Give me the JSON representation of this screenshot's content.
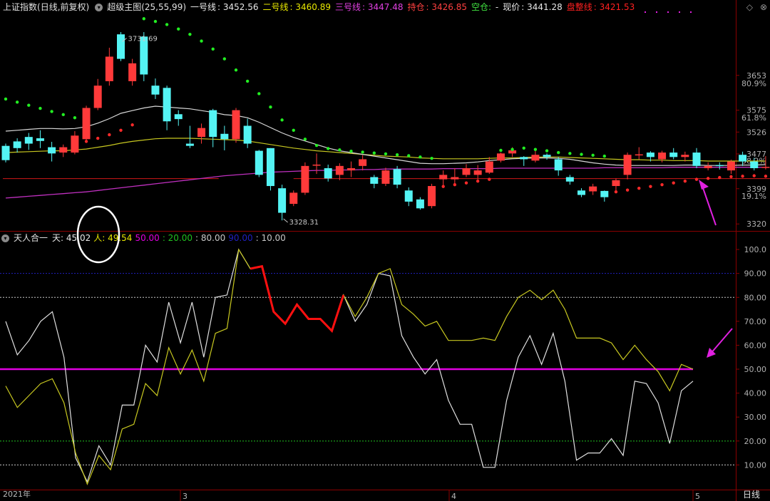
{
  "top_panel": {
    "index_name": "上证指数",
    "period_label": "(日线,前复权)",
    "indicator_name": "超级主图(25,55,99)",
    "lines": [
      {
        "label": "一号线",
        "value": "3452.56",
        "color": "#e8e8e8"
      },
      {
        "label": "二号线",
        "value": "3460.89",
        "color": "#e8e800"
      },
      {
        "label": "三号线",
        "value": "3447.48",
        "color": "#e040e0"
      },
      {
        "label": "持仓",
        "value": "3426.85",
        "color": "#ff4040"
      },
      {
        "label": "空仓",
        "value": "-",
        "color": "#40e040"
      },
      {
        "label": "现价",
        "value": "3441.28",
        "color": "#e8e8e8"
      },
      {
        "label": "盘整线",
        "value": "3421.53",
        "color": "#ff2020"
      }
    ],
    "y_ticks": [
      {
        "value": 3653,
        "label": "3653"
      },
      {
        "value": 3575,
        "label": "3575"
      },
      {
        "value": 3526,
        "label": "3526"
      },
      {
        "value": 3477,
        "label": "3477"
      },
      {
        "value": 3399,
        "label": "3399"
      },
      {
        "value": 3320,
        "label": "3320"
      }
    ],
    "pct_ticks": [
      {
        "value": 3635,
        "label": "80.9%"
      },
      {
        "value": 3558,
        "label": "61.8%"
      },
      {
        "value": 3462,
        "label": "38.2%"
      },
      {
        "value": 3383,
        "label": "19.1%"
      }
    ],
    "high_label": "3731.69",
    "low_label": "3328.31",
    "ylim": [
      3306,
      3790
    ]
  },
  "bottom_panel": {
    "indicator_name": "天人合一",
    "items": [
      {
        "label": "天: 45.02",
        "color": "#e8e8e8"
      },
      {
        "label": "人: 49.54",
        "color": "#e8e800"
      },
      {
        "label": "50.00",
        "color": "#e000e0"
      },
      {
        "label": ": 20.00",
        "color": "#20c020"
      },
      {
        "label": ": 80.00",
        "color": "#c8c8c8"
      },
      {
        "label": "90.00",
        "color": "#2020c0"
      },
      {
        "label": ": 10.00",
        "color": "#c8c8c8"
      }
    ],
    "y_ticks": [
      "100.0",
      "90.00",
      "80.00",
      "70.00",
      "60.00",
      "50.00",
      "40.00",
      "30.00",
      "20.00",
      "10.00"
    ],
    "ylim": [
      0,
      103
    ]
  },
  "x_axis": {
    "year_label": "2021年",
    "month_labels": [
      "3",
      "4",
      "5"
    ],
    "timeframe": "日线"
  },
  "colors": {
    "up": "#ff3a3a",
    "down": "#54f4f4",
    "sar_up": "#ff2a2a",
    "sar_down": "#22ee22"
  },
  "chart_data": [
    {
      "type": "candlestick",
      "title": "上证指数 超级主图(25,55,99)",
      "candles": [
        [
          3495,
          3463,
          3500,
          3458
        ],
        [
          3505,
          3490,
          3512,
          3480
        ],
        [
          3515,
          3500,
          3524,
          3486
        ],
        [
          3512,
          3506,
          3530,
          3490
        ],
        [
          3492,
          3478,
          3504,
          3460
        ],
        [
          3480,
          3492,
          3498,
          3470
        ],
        [
          3480,
          3518,
          3528,
          3476
        ],
        [
          3510,
          3580,
          3585,
          3506
        ],
        [
          3580,
          3630,
          3645,
          3575
        ],
        [
          3640,
          3695,
          3715,
          3630
        ],
        [
          3745,
          3690,
          3750,
          3685
        ],
        [
          3640,
          3680,
          3690,
          3630
        ],
        [
          3740,
          3655,
          3750,
          3640
        ],
        [
          3630,
          3610,
          3646,
          3600
        ],
        [
          3625,
          3550,
          3630,
          3530
        ],
        [
          3566,
          3555,
          3575,
          3540
        ],
        [
          3500,
          3495,
          3540,
          3490
        ],
        [
          3515,
          3535,
          3545,
          3500
        ],
        [
          3575,
          3515,
          3578,
          3492
        ],
        [
          3522,
          3510,
          3540,
          3485
        ],
        [
          3510,
          3575,
          3580,
          3502
        ],
        [
          3540,
          3500,
          3556,
          3490
        ],
        [
          3484,
          3430,
          3486,
          3425
        ],
        [
          3490,
          3405,
          3490,
          3395
        ],
        [
          3400,
          3345,
          3408,
          3328
        ],
        [
          3365,
          3390,
          3395,
          3360
        ],
        [
          3390,
          3450,
          3458,
          3385
        ],
        [
          3452,
          3453,
          3478,
          3432
        ],
        [
          3445,
          3422,
          3453,
          3415
        ],
        [
          3430,
          3450,
          3456,
          3418
        ],
        [
          3440,
          3445,
          3460,
          3425
        ],
        [
          3450,
          3465,
          3474,
          3440
        ],
        [
          3425,
          3410,
          3430,
          3400
        ],
        [
          3410,
          3440,
          3446,
          3405
        ],
        [
          3443,
          3408,
          3450,
          3400
        ],
        [
          3395,
          3370,
          3402,
          3360
        ],
        [
          3375,
          3355,
          3380,
          3352
        ],
        [
          3360,
          3405,
          3410,
          3355
        ],
        [
          3420,
          3430,
          3440,
          3406
        ],
        [
          3420,
          3425,
          3445,
          3405
        ],
        [
          3430,
          3445,
          3454,
          3425
        ],
        [
          3430,
          3440,
          3452,
          3420
        ],
        [
          3435,
          3460,
          3470,
          3432
        ],
        [
          3462,
          3478,
          3480,
          3458
        ],
        [
          3478,
          3485,
          3492,
          3470
        ],
        [
          3470,
          3465,
          3472,
          3450
        ],
        [
          3462,
          3475,
          3487,
          3458
        ],
        [
          3475,
          3470,
          3478,
          3464
        ],
        [
          3465,
          3440,
          3470,
          3428
        ],
        [
          3425,
          3415,
          3430,
          3408
        ],
        [
          3395,
          3385,
          3400,
          3380
        ],
        [
          3393,
          3404,
          3410,
          3385
        ],
        [
          3394,
          3380,
          3395,
          3370
        ],
        [
          3405,
          3418,
          3422,
          3395
        ],
        [
          3430,
          3475,
          3480,
          3420
        ],
        [
          3475,
          3476,
          3492,
          3465
        ],
        [
          3480,
          3470,
          3483,
          3460
        ],
        [
          3465,
          3480,
          3484,
          3458
        ],
        [
          3480,
          3470,
          3490,
          3465
        ],
        [
          3470,
          3475,
          3482,
          3460
        ],
        [
          3480,
          3450,
          3490,
          3445
        ],
        [
          3445,
          3450,
          3458,
          3440
        ],
        [
          3452,
          3450,
          3458,
          3442
        ],
        [
          3440,
          3460,
          3464,
          3432
        ],
        [
          3475,
          3460,
          3482,
          3450
        ],
        [
          3460,
          3445,
          3468,
          3440
        ],
        [
          3446,
          3448,
          3472,
          3442
        ]
      ],
      "line1": [
        3528,
        3530,
        3532,
        3534,
        3534,
        3533,
        3534,
        3538,
        3546,
        3556,
        3568,
        3574,
        3580,
        3584,
        3582,
        3580,
        3578,
        3574,
        3570,
        3565,
        3563,
        3558,
        3548,
        3536,
        3524,
        3514,
        3506,
        3498,
        3490,
        3484,
        3480,
        3476,
        3472,
        3468,
        3464,
        3460,
        3456,
        3455,
        3455,
        3456,
        3457,
        3459,
        3462,
        3464,
        3466,
        3467,
        3468,
        3468,
        3467,
        3465,
        3461,
        3457,
        3454,
        3452,
        3451,
        3451,
        3451,
        3451,
        3451,
        3452,
        3452,
        3451,
        3451,
        3451,
        3452,
        3452,
        3453
      ],
      "line2": [
        3480,
        3481,
        3482,
        3483,
        3484,
        3484,
        3486,
        3488,
        3492,
        3496,
        3501,
        3505,
        3508,
        3511,
        3512,
        3512,
        3512,
        3511,
        3510,
        3509,
        3508,
        3506,
        3502,
        3498,
        3494,
        3490,
        3487,
        3484,
        3482,
        3480,
        3478,
        3476,
        3474,
        3472,
        3471,
        3470,
        3468,
        3467,
        3466,
        3466,
        3466,
        3466,
        3467,
        3468,
        3468,
        3469,
        3470,
        3470,
        3470,
        3469,
        3468,
        3467,
        3466,
        3465,
        3464,
        3464,
        3463,
        3463,
        3462,
        3462,
        3462,
        3461,
        3461,
        3461,
        3461,
        3461,
        3461
      ],
      "line3": [
        3378,
        3380,
        3382,
        3384,
        3386,
        3388,
        3390,
        3392,
        3395,
        3398,
        3401,
        3404,
        3407,
        3410,
        3413,
        3416,
        3419,
        3422,
        3425,
        3428,
        3430,
        3432,
        3434,
        3436,
        3437,
        3438,
        3439,
        3440,
        3440,
        3441,
        3441,
        3442,
        3442,
        3443,
        3443,
        3443,
        3443,
        3443,
        3444,
        3444,
        3444,
        3444,
        3444,
        3445,
        3445,
        3445,
        3445,
        3445,
        3445,
        3445,
        3445,
        3445,
        3446,
        3446,
        3446,
        3446,
        3446,
        3446,
        3447,
        3447,
        3447,
        3447,
        3447,
        3447,
        3447,
        3447,
        3447
      ],
      "sar_down": [
        3600,
        3593,
        3586,
        3579,
        3572,
        3565,
        3558,
        null,
        null,
        null,
        null,
        null,
        3780,
        3774,
        3767,
        3757,
        3745,
        3730,
        3712,
        3690,
        3665,
        3640,
        3612,
        3582,
        3553,
        3530,
        3510,
        3496,
        3489,
        3486,
        3483,
        3481,
        3479,
        3477,
        3475,
        3473,
        3470,
        3467,
        null,
        null,
        null,
        null,
        null,
        3485,
        3487,
        3490,
        3487,
        3484,
        3480,
        3478,
        3476,
        3474,
        3472,
        null,
        null,
        null,
        null,
        null,
        null,
        null,
        null,
        null,
        null,
        null,
        null,
        null,
        null
      ],
      "sar_up": [
        null,
        null,
        null,
        null,
        null,
        null,
        null,
        3505,
        3512,
        3520,
        3530,
        3542,
        null,
        null,
        null,
        null,
        null,
        null,
        null,
        null,
        null,
        null,
        null,
        null,
        null,
        null,
        null,
        null,
        null,
        null,
        null,
        null,
        null,
        null,
        null,
        null,
        null,
        null,
        3404,
        3408,
        3412,
        3416,
        3420,
        null,
        null,
        null,
        null,
        null,
        null,
        null,
        null,
        null,
        null,
        3392,
        3396,
        3400,
        3404,
        3408,
        3412,
        3416,
        3420,
        3422,
        3424,
        3426,
        3427,
        3428,
        3427
      ],
      "consolidation_line": 3421.53,
      "consolidation_span": [
        0,
        18
      ]
    },
    {
      "type": "line",
      "title": "天人合一",
      "series": [
        {
          "name": "天",
          "values": [
            70,
            56,
            62,
            70,
            74,
            55,
            13,
            3,
            18,
            10,
            35,
            35,
            60,
            53,
            78,
            61,
            78,
            55,
            80,
            81,
            100,
            92,
            93,
            74,
            69,
            77,
            71,
            71,
            66,
            81,
            70,
            77,
            90,
            89,
            64,
            55,
            48,
            54,
            37,
            27,
            27,
            9,
            9,
            37,
            55,
            64,
            52,
            65,
            45,
            12,
            15,
            15,
            21,
            14,
            45,
            44,
            36,
            19,
            41,
            45
          ]
        },
        {
          "name": "人",
          "values": [
            43,
            34,
            39,
            44,
            46,
            36,
            15,
            2,
            14,
            8,
            25,
            27,
            44,
            39,
            59,
            48,
            58,
            45,
            65,
            67,
            100,
            92,
            93,
            74,
            69,
            77,
            71,
            71,
            66,
            81,
            72,
            80,
            90,
            92,
            77,
            73,
            68,
            70,
            62,
            62,
            62,
            63,
            62,
            72,
            80,
            83,
            79,
            83,
            75,
            63,
            63,
            63,
            61,
            54,
            60,
            54,
            49,
            41,
            52,
            50
          ]
        }
      ],
      "highlight_range": [
        21,
        29
      ],
      "ylim": [
        0,
        100
      ]
    }
  ]
}
